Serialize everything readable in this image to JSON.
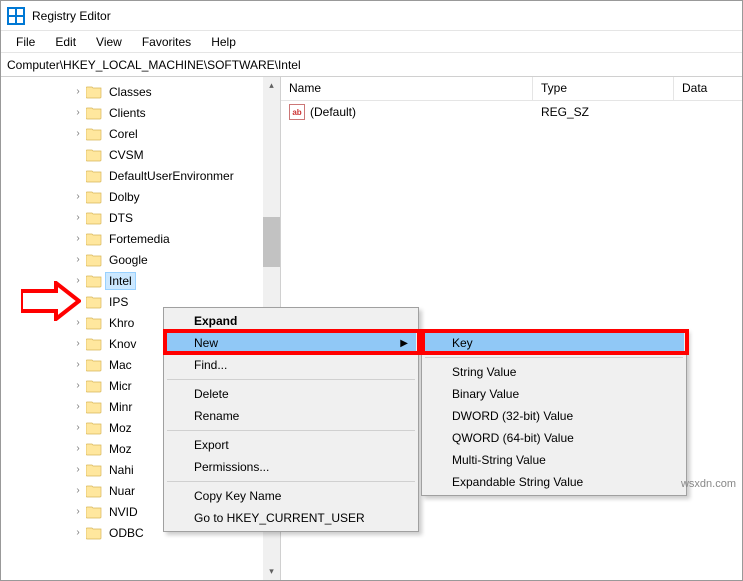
{
  "title": "Registry Editor",
  "menubar": [
    "File",
    "Edit",
    "View",
    "Favorites",
    "Help"
  ],
  "address": "Computer\\HKEY_LOCAL_MACHINE\\SOFTWARE\\Intel",
  "tree": [
    {
      "label": "Classes",
      "exp": true
    },
    {
      "label": "Clients",
      "exp": true
    },
    {
      "label": "Corel",
      "exp": true
    },
    {
      "label": "CVSM",
      "exp": false
    },
    {
      "label": "DefaultUserEnvironment",
      "exp": false,
      "trunc": "DefaultUserEnvironmer"
    },
    {
      "label": "Dolby",
      "exp": true
    },
    {
      "label": "DTS",
      "exp": true
    },
    {
      "label": "Fortemedia",
      "exp": true
    },
    {
      "label": "Google",
      "exp": true
    },
    {
      "label": "Intel",
      "exp": true,
      "selected": true
    },
    {
      "label": "IPS",
      "exp": true
    },
    {
      "label": "Khronos",
      "exp": true,
      "trunc": "Khro"
    },
    {
      "label": "KnownApps",
      "exp": true,
      "trunc": "Knov"
    },
    {
      "label": "Macromedia",
      "exp": true,
      "trunc": "Mac"
    },
    {
      "label": "Microsoft",
      "exp": true,
      "trunc": "Micr"
    },
    {
      "label": "MiniTool",
      "exp": true,
      "trunc": "Minr"
    },
    {
      "label": "Mozilla",
      "exp": true,
      "trunc": "Moz"
    },
    {
      "label": "MozillaPlugins",
      "exp": true,
      "trunc": "Moz"
    },
    {
      "label": "Nahimic",
      "exp": true,
      "trunc": "Nahi"
    },
    {
      "label": "Nuance",
      "exp": true,
      "trunc": "Nuar"
    },
    {
      "label": "NVIDIA",
      "exp": true,
      "trunc": "NVID"
    },
    {
      "label": "ODBC",
      "exp": true
    }
  ],
  "columns": {
    "name": "Name",
    "type": "Type",
    "data": "Data"
  },
  "values": [
    {
      "name": "(Default)",
      "type": "REG_SZ",
      "data": ""
    }
  ],
  "ctx1": {
    "expand": "Expand",
    "new": "New",
    "find": "Find...",
    "delete": "Delete",
    "rename": "Rename",
    "export": "Export",
    "permissions": "Permissions...",
    "copykey": "Copy Key Name",
    "goto": "Go to HKEY_CURRENT_USER"
  },
  "ctx2": {
    "key": "Key",
    "string": "String Value",
    "binary": "Binary Value",
    "dword": "DWORD (32-bit) Value",
    "qword": "QWORD (64-bit) Value",
    "multi": "Multi-String Value",
    "expand": "Expandable String Value"
  },
  "watermark": "wsxdn.com"
}
